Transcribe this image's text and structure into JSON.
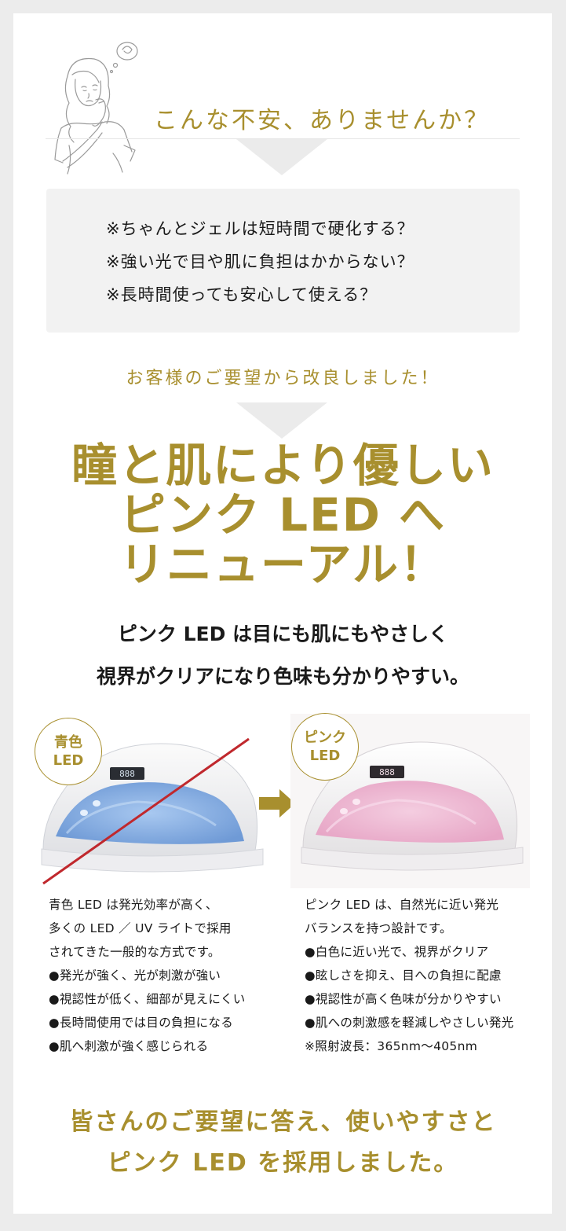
{
  "header": {
    "title": "こんな不安、ありませんか？"
  },
  "concerns": [
    "※ちゃんとジェルは短時間で硬化する？",
    "※強い光で目や肌に負担はかからない？",
    "※長時間使っても安心して使える？"
  ],
  "improved": "お客様のご要望から改良しました！",
  "headline": [
    "瞳と肌により優しい",
    "ピンク LED へ",
    "リニューアル！"
  ],
  "subheading": [
    "ピンク LED は目にも肌にもやさしく",
    "視界がクリアになり色味も分かりやすい。"
  ],
  "comparison": {
    "blue": {
      "badge": [
        "青色",
        "LED"
      ],
      "display": "888",
      "lines": [
        "青色 LED は発光効率が高く、",
        "多くの LED ／ UV ライトで採用",
        "されてきた一般的な方式です。",
        "●発光が強く、光が刺激が強い",
        "●視認性が低く、細部が見えにくい",
        "●長時間使用では目の負担になる",
        "●肌へ刺激が強く感じられる"
      ]
    },
    "pink": {
      "badge": [
        "ピンク",
        "LED"
      ],
      "display": "888",
      "lines": [
        "ピンク LED は、自然光に近い発光",
        "バランスを持つ設計です。",
        "●白色に近い光で、視界がクリア",
        "●眩しさを抑え、目への負担に配慮",
        "●視認性が高く色味が分かりやすい",
        "●肌への刺激感を軽減しやさしい発光",
        "※照射波長：365nm〜405nm"
      ]
    }
  },
  "closing": [
    "皆さんのご要望に答え、使いやすさと",
    "ピンク LED を採用しました。"
  ],
  "colors": {
    "accent": "#a88f2e",
    "strike": "#c0282d",
    "box": "#f2f2f2",
    "background": "#ececec"
  }
}
